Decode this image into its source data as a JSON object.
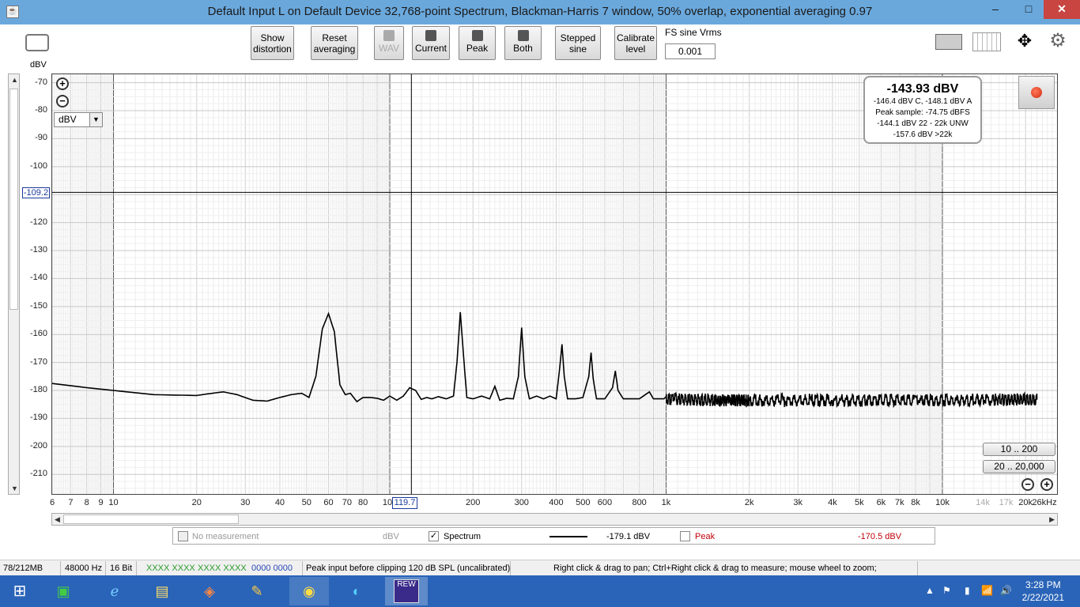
{
  "window": {
    "title": "Default Input L on Default Device 32,768-point Spectrum, Blackman-Harris 7 window, 50% overlap, exponential averaging 0.97",
    "min": "–",
    "max": "□",
    "close": "✕"
  },
  "toolbar": {
    "show_distortion": "Show\ndistortion",
    "reset_averaging": "Reset\naveraging",
    "wav": "WAV",
    "current": "Current",
    "peak": "Peak",
    "both": "Both",
    "stepped_sine": "Stepped\nsine",
    "calibrate_level": "Calibrate\nlevel",
    "fs_label": "FS sine Vrms",
    "fs_value": "0.001"
  },
  "plot": {
    "y_unit_label": "dBV",
    "unit_select": "dBV",
    "cursor_y": "-109.2",
    "cursor_x": "119.7",
    "range_1": "10 .. 200",
    "range_2": "20 .. 20,000"
  },
  "info": {
    "main": "-143.93 dBV",
    "line1": "-146.4 dBV C, -148.1 dBV A",
    "line2": "Peak sample: -74.75 dBFS",
    "line3": "-144.1 dBV 22 - 22k UNW",
    "line4": "-157.6 dBV >22k"
  },
  "legend": {
    "no_measurement": "No measurement",
    "no_measurement_unit": "dBV",
    "spectrum": "Spectrum",
    "spectrum_value": "-179.1 dBV",
    "peak": "Peak",
    "peak_value": "-170.5 dBV",
    "peak_color": "#c0000a"
  },
  "status": {
    "memory": "78/212MB",
    "rate": "48000 Hz",
    "bits": "16 Bit",
    "in_meter": "XXXX XXXX",
    "out_meter": "XXXX XXXX",
    "digits": "0000 0000",
    "peak_input": "Peak input before clipping 120 dB SPL (uncalibrated)",
    "hint": "Right click & drag to pan; Ctrl+Right click & drag to measure; mouse wheel to zoom;"
  },
  "taskbar": {
    "time": "3:28 PM",
    "date": "2/22/2021",
    "rew": "REW"
  },
  "chart_data": {
    "type": "line",
    "xscale": "log",
    "xlim": [
      6,
      26000
    ],
    "ylim": [
      -217,
      -67
    ],
    "y_ticks": [
      -70,
      -80,
      -90,
      -100,
      -110,
      -120,
      -130,
      -140,
      -150,
      -160,
      -170,
      -180,
      -190,
      -200,
      -210
    ],
    "x_tick_labels": [
      {
        "v": 6,
        "t": "6"
      },
      {
        "v": 7,
        "t": "7"
      },
      {
        "v": 8,
        "t": "8"
      },
      {
        "v": 9,
        "t": "9"
      },
      {
        "v": 10,
        "t": "10"
      },
      {
        "v": 20,
        "t": "20"
      },
      {
        "v": 30,
        "t": "30"
      },
      {
        "v": 40,
        "t": "40"
      },
      {
        "v": 50,
        "t": "50"
      },
      {
        "v": 60,
        "t": "60"
      },
      {
        "v": 70,
        "t": "70"
      },
      {
        "v": 80,
        "t": "80"
      },
      {
        "v": 100,
        "t": "100"
      },
      {
        "v": 200,
        "t": "200"
      },
      {
        "v": 300,
        "t": "300"
      },
      {
        "v": 400,
        "t": "400"
      },
      {
        "v": 500,
        "t": "500"
      },
      {
        "v": 600,
        "t": "600"
      },
      {
        "v": 800,
        "t": "800"
      },
      {
        "v": 1000,
        "t": "1k"
      },
      {
        "v": 2000,
        "t": "2k"
      },
      {
        "v": 3000,
        "t": "3k"
      },
      {
        "v": 4000,
        "t": "4k"
      },
      {
        "v": 5000,
        "t": "5k"
      },
      {
        "v": 6000,
        "t": "6k"
      },
      {
        "v": 7000,
        "t": "7k"
      },
      {
        "v": 8000,
        "t": "8k"
      },
      {
        "v": 10000,
        "t": "10k"
      },
      {
        "v": 14000,
        "t": "14k"
      },
      {
        "v": 17000,
        "t": "17k"
      },
      {
        "v": 20000,
        "t": "20k"
      },
      {
        "v": 26000,
        "t": "26kHz"
      }
    ],
    "cursor": {
      "x": 119.7,
      "y": -109.2
    },
    "series": [
      {
        "name": "Spectrum",
        "color": "#000000",
        "points": [
          [
            6,
            -177.5
          ],
          [
            8,
            -179
          ],
          [
            10,
            -180
          ],
          [
            14,
            -181.5
          ],
          [
            20,
            -181.8
          ],
          [
            22,
            -181.2
          ],
          [
            25,
            -180.5
          ],
          [
            28,
            -181.5
          ],
          [
            32,
            -183.5
          ],
          [
            36,
            -183.8
          ],
          [
            40,
            -182.5
          ],
          [
            44,
            -181.5
          ],
          [
            48,
            -181
          ],
          [
            51,
            -182.5
          ],
          [
            54,
            -175
          ],
          [
            57,
            -158
          ],
          [
            60,
            -152.5
          ],
          [
            63,
            -159
          ],
          [
            66,
            -178
          ],
          [
            69,
            -181.5
          ],
          [
            72,
            -181
          ],
          [
            76,
            -184
          ],
          [
            80,
            -182.5
          ],
          [
            85,
            -182.5
          ],
          [
            90,
            -182.8
          ],
          [
            95,
            -183.5
          ],
          [
            100,
            -182
          ],
          [
            106,
            -183.5
          ],
          [
            112,
            -182
          ],
          [
            118,
            -179
          ],
          [
            124,
            -180
          ],
          [
            130,
            -183.2
          ],
          [
            136,
            -182.5
          ],
          [
            142,
            -183
          ],
          [
            150,
            -182.2
          ],
          [
            160,
            -183
          ],
          [
            170,
            -182
          ],
          [
            175,
            -170
          ],
          [
            180,
            -152
          ],
          [
            185,
            -168
          ],
          [
            190,
            -182.5
          ],
          [
            200,
            -183
          ],
          [
            215,
            -182
          ],
          [
            230,
            -183
          ],
          [
            240,
            -178.5
          ],
          [
            250,
            -183.5
          ],
          [
            265,
            -182.8
          ],
          [
            280,
            -183
          ],
          [
            292,
            -175
          ],
          [
            300,
            -157.5
          ],
          [
            308,
            -175
          ],
          [
            320,
            -183
          ],
          [
            340,
            -182
          ],
          [
            360,
            -183
          ],
          [
            380,
            -182
          ],
          [
            400,
            -183
          ],
          [
            412,
            -172
          ],
          [
            420,
            -163.5
          ],
          [
            428,
            -175
          ],
          [
            440,
            -183
          ],
          [
            470,
            -183
          ],
          [
            500,
            -182.5
          ],
          [
            525,
            -175
          ],
          [
            535,
            -166.5
          ],
          [
            545,
            -176
          ],
          [
            560,
            -183
          ],
          [
            600,
            -183
          ],
          [
            640,
            -179
          ],
          [
            655,
            -173
          ],
          [
            670,
            -180
          ],
          [
            700,
            -183
          ],
          [
            800,
            -183
          ],
          [
            870,
            -180.5
          ],
          [
            900,
            -183
          ],
          [
            1000,
            -183
          ],
          [
            1500,
            -183.5
          ],
          [
            2000,
            -183.5
          ],
          [
            4000,
            -183.5
          ],
          [
            8000,
            -183.5
          ],
          [
            15000,
            -183.3
          ],
          [
            22000,
            -183.3
          ]
        ]
      }
    ]
  }
}
